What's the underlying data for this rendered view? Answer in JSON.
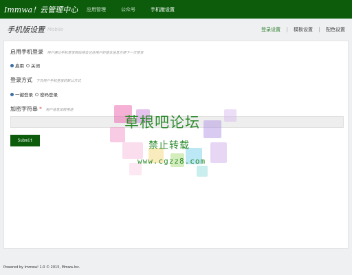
{
  "app": {
    "brand": "Immwa！云管理中心",
    "nav": [
      {
        "label": "应用管理"
      },
      {
        "label": "公众号"
      },
      {
        "label": "手机版设置"
      }
    ]
  },
  "page": {
    "title": "手机版设置",
    "subtitle": "Mobile",
    "tabs": [
      {
        "label": "登录设置"
      },
      {
        "label": "模板设置"
      },
      {
        "label": "配色设置"
      }
    ]
  },
  "form": {
    "enable": {
      "label": "启用手机登录",
      "hint": "用户通过手机登录网站将会记住用户的基本信息方便下一次登录",
      "options": [
        {
          "label": "启用",
          "checked": true
        },
        {
          "label": "关闭",
          "checked": false
        }
      ]
    },
    "method": {
      "label": "登录方式",
      "hint": "下次用户手机登录的默认方式",
      "options": [
        {
          "label": "一键登录",
          "checked": true
        },
        {
          "label": "密码登录",
          "checked": false
        }
      ]
    },
    "secret": {
      "label": "加密字符串",
      "required_mark": "*",
      "hint": "用户信息加密用途",
      "value": ""
    },
    "submit_label": "Submit"
  },
  "footer": "Powered by Immwa! 1.0 © 2015, Mmwa.Inc.",
  "watermark": {
    "line1": "草根吧论坛",
    "line2": "禁止转载",
    "line3": "www.cgzz8.com"
  },
  "colors": {
    "brand_green": "#0c5c0c",
    "active_tab": "#2e7d2e",
    "required": "#d9534f"
  }
}
